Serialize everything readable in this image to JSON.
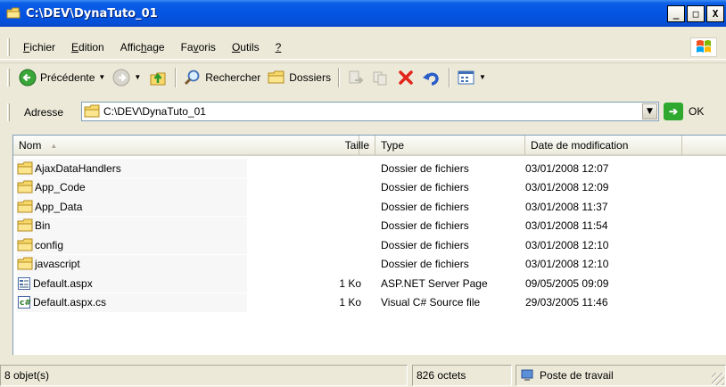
{
  "window": {
    "title": "C:\\DEV\\DynaTuto_01",
    "buttons": {
      "minimize": "_",
      "maximize": "□",
      "close": "X"
    }
  },
  "menu": [
    {
      "label": "Fichier",
      "u": "F"
    },
    {
      "label": "Edition",
      "u": "E"
    },
    {
      "label": "Affichage",
      "u": "h"
    },
    {
      "label": "Favoris",
      "u": "v"
    },
    {
      "label": "Outils",
      "u": "O"
    },
    {
      "label": "?",
      "u": "?"
    }
  ],
  "toolbar": {
    "back_label": "Précédente",
    "search_label": "Rechercher",
    "folders_label": "Dossiers"
  },
  "address": {
    "label": "Adresse",
    "value": "C:\\DEV\\DynaTuto_01",
    "go_label": "OK"
  },
  "columns": {
    "name": "Nom",
    "size": "Taille",
    "type": "Type",
    "date": "Date de modification"
  },
  "files": [
    {
      "name": "AjaxDataHandlers",
      "size": "",
      "type": "Dossier de fichiers",
      "date": "03/01/2008 12:07",
      "icon": "folder"
    },
    {
      "name": "App_Code",
      "size": "",
      "type": "Dossier de fichiers",
      "date": "03/01/2008 12:09",
      "icon": "folder"
    },
    {
      "name": "App_Data",
      "size": "",
      "type": "Dossier de fichiers",
      "date": "03/01/2008 11:37",
      "icon": "folder"
    },
    {
      "name": "Bin",
      "size": "",
      "type": "Dossier de fichiers",
      "date": "03/01/2008 11:54",
      "icon": "folder"
    },
    {
      "name": "config",
      "size": "",
      "type": "Dossier de fichiers",
      "date": "03/01/2008 12:10",
      "icon": "folder"
    },
    {
      "name": "javascript",
      "size": "",
      "type": "Dossier de fichiers",
      "date": "03/01/2008 12:10",
      "icon": "folder"
    },
    {
      "name": "Default.aspx",
      "size": "1 Ko",
      "type": "ASP.NET Server Page",
      "date": "09/05/2005 09:09",
      "icon": "aspx"
    },
    {
      "name": "Default.aspx.cs",
      "size": "1 Ko",
      "type": "Visual C# Source file",
      "date": "29/03/2005 11:46",
      "icon": "cs"
    }
  ],
  "status": {
    "count": "8 objet(s)",
    "size": "826 octets",
    "location": "Poste de travail"
  }
}
